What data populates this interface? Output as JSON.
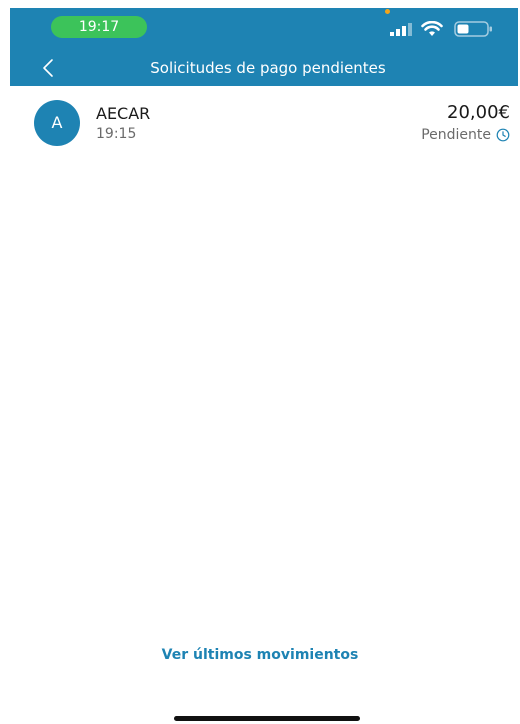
{
  "status_bar": {
    "time": "19:17",
    "signal_icon": "cellular-signal-icon",
    "wifi_icon": "wifi-icon",
    "battery_icon": "battery-icon",
    "colors": {
      "time_pill": "#3cc35a",
      "mic_dot": "#f3a51b"
    }
  },
  "nav": {
    "back_icon": "chevron-left-icon",
    "title": "Solicitudes de pago pendientes",
    "background": "#1e83b3"
  },
  "requests": [
    {
      "avatar_initial": "A",
      "name": "AECAR",
      "time": "19:15",
      "amount": "20,00€",
      "status": "Pendiente",
      "status_icon": "clock-icon"
    }
  ],
  "footer": {
    "link_label": "Ver últimos movimientos"
  },
  "theme": {
    "accent": "#1e83b3",
    "text_primary": "#1a1a1a",
    "text_secondary": "#6b6b6b"
  }
}
